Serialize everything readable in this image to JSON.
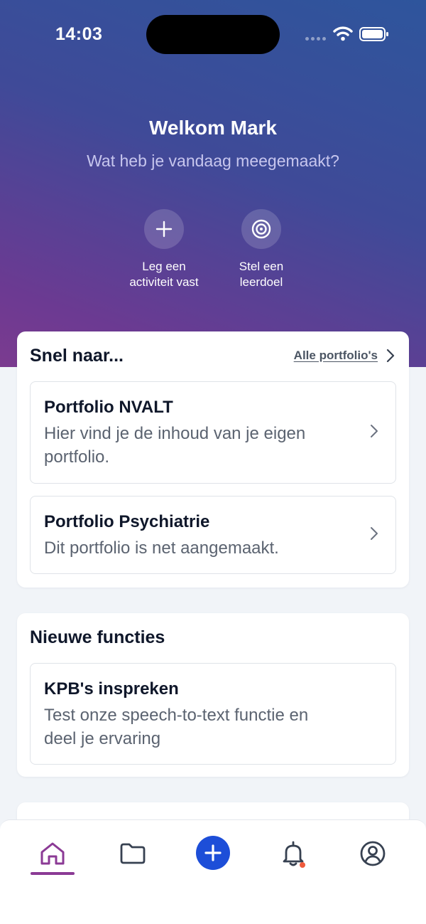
{
  "status_bar": {
    "time": "14:03"
  },
  "header": {
    "welcome": "Welkom Mark",
    "subtitle": "Wat heb je vandaag meegemaakt?",
    "actions": [
      {
        "label_line1": "Leg een",
        "label_line2": "activiteit vast",
        "icon": "plus-icon"
      },
      {
        "label_line1": "Stel een",
        "label_line2": "leerdoel",
        "icon": "target-icon"
      }
    ]
  },
  "quick_access": {
    "title": "Snel naar...",
    "all_link": "Alle portfolio's",
    "items": [
      {
        "title": "Portfolio NVALT",
        "description": "Hier vind je de inhoud van je eigen portfolio."
      },
      {
        "title": "Portfolio Psychiatrie",
        "description": "Dit portfolio is net aangemaakt."
      }
    ]
  },
  "new_features": {
    "title": "Nieuwe functies",
    "items": [
      {
        "title": "KPB's inspreken",
        "description": "Test onze speech-to-text functie en deel je ervaring"
      }
    ]
  },
  "tab_bar": {
    "tabs": [
      "home-icon",
      "folder-icon",
      "add-icon",
      "bell-icon",
      "profile-icon"
    ],
    "active": "home-icon",
    "notification_badge": true
  },
  "colors": {
    "accent": "#8b3a95",
    "primary_button": "#1d4ed8",
    "badge": "#ef5a3c"
  }
}
